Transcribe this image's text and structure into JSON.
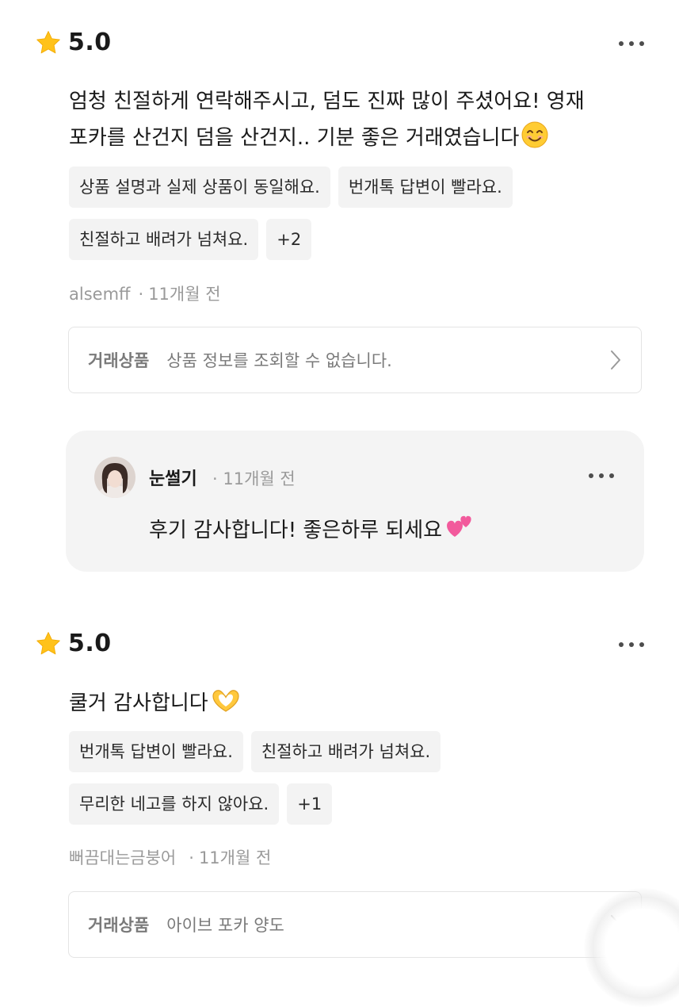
{
  "reviews": [
    {
      "rating": "5.0",
      "text_line1": "엄청 친절하게 연락해주시고, 덤도 진짜 많이 주셨어요! 영재",
      "text_line2": "포카를 산건지 덤을 산건지.. 기분 좋은 거래였습니다",
      "emoji": "smiling-face",
      "tags": [
        "상품 설명과 실제 상품이 동일해요.",
        "번개톡 답변이 빨라요.",
        "친절하고 배려가 넘쳐요.",
        "+2"
      ],
      "reviewer": "alsemff",
      "time": "11개월 전",
      "product_label": "거래상품",
      "product_info": "상품 정보를 조회할 수 없습니다.",
      "reply": {
        "seller": "눈썰기",
        "time": "11개월 전",
        "text": "후기 감사합니다! 좋은하루 되세요",
        "emoji": "two-hearts"
      }
    },
    {
      "rating": "5.0",
      "text_line1": "쿨거 감사합니다",
      "emoji": "heart-hands",
      "tags": [
        "번개톡 답변이 빨라요.",
        "친절하고 배려가 넘쳐요.",
        "무리한 네고를 하지 않아요.",
        "+1"
      ],
      "reviewer": "뻐끔대는금붕어",
      "time": "11개월 전",
      "product_label": "거래상품",
      "product_info": "아이브 포카 양도"
    }
  ],
  "separator": "·",
  "colors": {
    "star": "#FFC21A",
    "tag_bg": "#F3F3F3",
    "reply_bg": "#F4F4F4",
    "meta_text": "#9A9A9A"
  }
}
